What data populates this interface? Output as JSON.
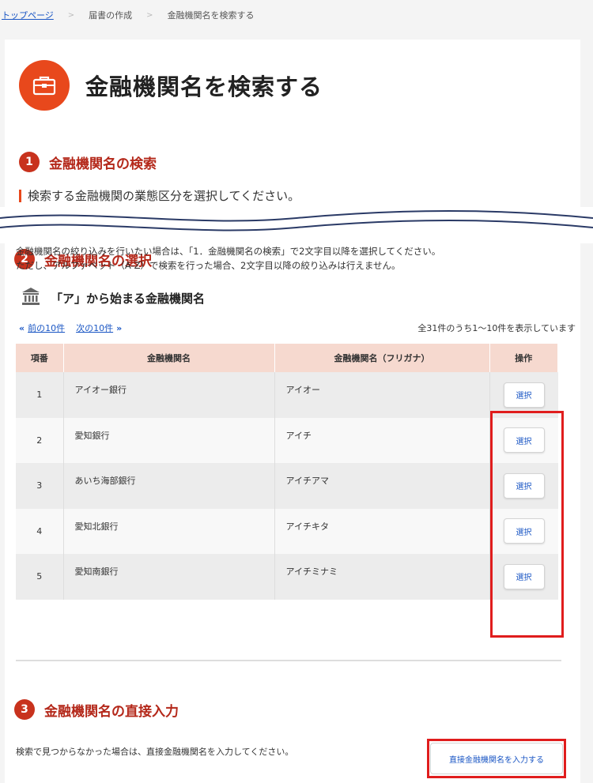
{
  "breadcrumb": {
    "home": "トップページ",
    "parent": "届書の作成",
    "current": "金融機関名を検索する",
    "separator": ">"
  },
  "page": {
    "title": "金融機関名を検索する",
    "icon": "briefcase-icon",
    "accent_color": "#e8481c"
  },
  "section1": {
    "step": "1",
    "title": "金融機関名の検索",
    "note": "検索する金融機関の業態区分を選択してください。"
  },
  "section2": {
    "step": "2",
    "title": "金融機関名の選択",
    "description_line1": "金融機関名の絞り込みを行いたい場合は、「1．金融機関名の検索」で2文字目以降を選択してください。",
    "description_line2": "ただし、アルファベット（A-Z）で検索を行った場合、2文字目以降の絞り込みは行えません。",
    "subheading": "「ア」から始まる金融機関名",
    "subheading_icon": "bank-icon",
    "pager": {
      "prev": "前の10件",
      "next": "次の10件"
    },
    "count_text": "全31件のうち1〜10件を表示しています",
    "table": {
      "headers": [
        "項番",
        "金融機関名",
        "金融機関名（フリガナ）",
        "操作"
      ],
      "rows": [
        {
          "no": "1",
          "name": "アイオー銀行",
          "kana": "アイオー",
          "action": "選択"
        },
        {
          "no": "2",
          "name": "愛知銀行",
          "kana": "アイチ",
          "action": "選択"
        },
        {
          "no": "3",
          "name": "あいち海部銀行",
          "kana": "アイチアマ",
          "action": "選択"
        },
        {
          "no": "4",
          "name": "愛知北銀行",
          "kana": "アイチキタ",
          "action": "選択"
        },
        {
          "no": "5",
          "name": "愛知南銀行",
          "kana": "アイチミナミ",
          "action": "選択"
        }
      ]
    }
  },
  "section3": {
    "step": "3",
    "title": "金融機関名の直接入力",
    "description": "検索で見つからなかった場合は、直接金融機関名を入力してください。",
    "button_label": "直接金融機関名を入力する"
  },
  "colors": {
    "step_circle": "#c8321d",
    "section_title": "#b4281a",
    "link": "#1a56c4",
    "table_header": "#f6d9cf",
    "highlight": "#e01d1d"
  }
}
